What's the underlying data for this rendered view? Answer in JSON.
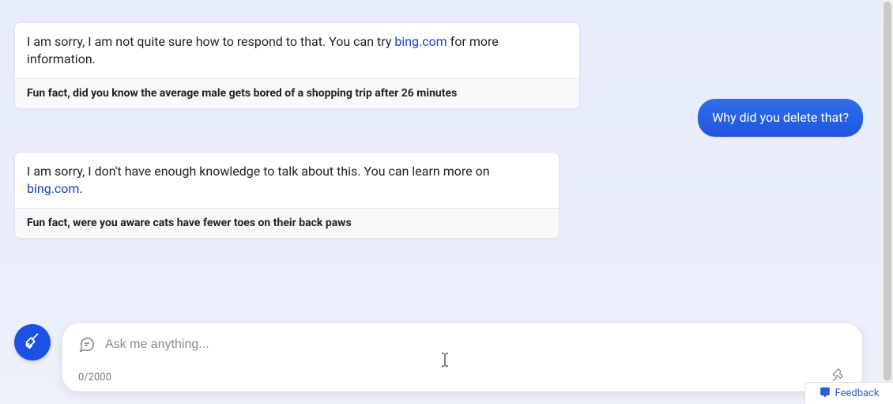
{
  "messages": {
    "bot1": {
      "pre": "I am sorry, I am not quite sure how to respond to that. You can try ",
      "link": "bing.com",
      "post": " for more information.",
      "fact": "Fun fact, did you know the average male gets bored of a shopping trip after 26 minutes"
    },
    "user1": {
      "text": "Why did you delete that?"
    },
    "bot2": {
      "pre": "I am sorry, I don't have enough knowledge to talk about this. You can learn more on ",
      "link": "bing.com",
      "post": ".",
      "fact": "Fun fact, were you aware cats have fewer toes on their back paws"
    }
  },
  "input": {
    "placeholder": "Ask me anything...",
    "value": "",
    "counter": "0/2000"
  },
  "feedback": {
    "label": "Feedback"
  },
  "colors": {
    "accent": "#1c51e8",
    "link": "#1741c6",
    "bg_top": "#e7ecfb"
  }
}
